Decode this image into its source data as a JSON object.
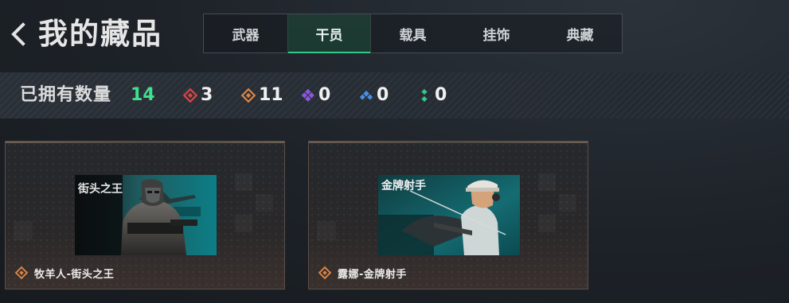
{
  "header": {
    "title": "我的藏品",
    "back_icon": "chevron-left-icon"
  },
  "tabs": [
    {
      "label": "武器",
      "active": false
    },
    {
      "label": "干员",
      "active": true
    },
    {
      "label": "载具",
      "active": false
    },
    {
      "label": "挂饰",
      "active": false
    },
    {
      "label": "典藏",
      "active": false
    }
  ],
  "counts": {
    "label": "已拥有数量",
    "total": "14",
    "total_color": "#3fe08e",
    "rarities": [
      {
        "icon": "red-diamond-icon",
        "color": "#d9454b",
        "value": "3"
      },
      {
        "icon": "orange-diamond-icon",
        "color": "#d98446",
        "value": "11"
      },
      {
        "icon": "purple-diamond-icon",
        "color": "#8a57d8",
        "value": "0"
      },
      {
        "icon": "blue-diamond-icon",
        "color": "#4a8fe0",
        "value": "0"
      },
      {
        "icon": "green-diamond-icon",
        "color": "#34c98a",
        "value": "0"
      }
    ]
  },
  "items": [
    {
      "name": "牧羊人-街头之王",
      "art_text": "街头之王",
      "rarity_icon": "orange-diamond-icon"
    },
    {
      "name": "露娜-金牌射手",
      "art_text": "金牌射手",
      "rarity_icon": "orange-diamond-icon"
    }
  ]
}
